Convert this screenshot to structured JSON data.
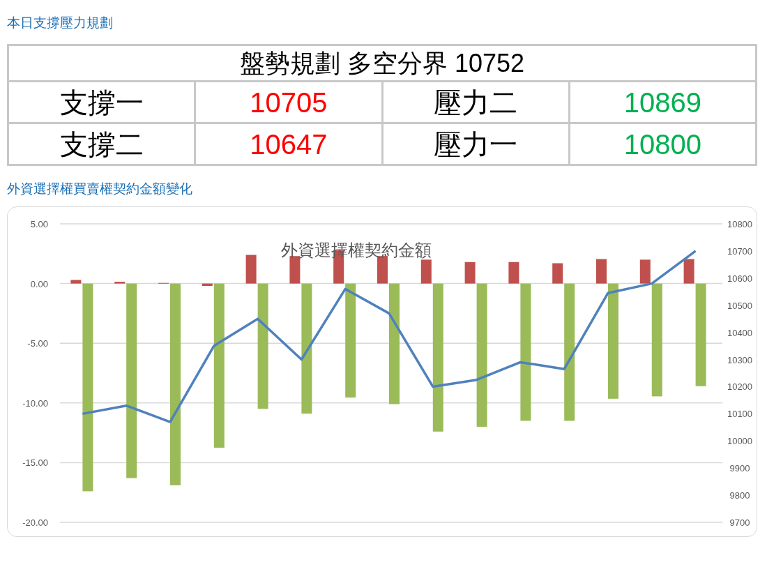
{
  "section1_heading": "本日支撐壓力規劃",
  "plan_table": {
    "title": "盤勢規劃 多空分界 10752",
    "rows": [
      [
        {
          "text": "支撐一",
          "kind": "label"
        },
        {
          "text": "10705",
          "kind": "support"
        },
        {
          "text": "壓力二",
          "kind": "label"
        },
        {
          "text": "10869",
          "kind": "resistance"
        }
      ],
      [
        {
          "text": "支撐二",
          "kind": "label"
        },
        {
          "text": "10647",
          "kind": "support"
        },
        {
          "text": "壓力一",
          "kind": "label"
        },
        {
          "text": "10800",
          "kind": "resistance"
        }
      ]
    ]
  },
  "section2_heading": "外資選擇權買賣權契約金額變化",
  "chart": {
    "chart_data": {
      "type": "bar",
      "title": "外資選擇權契約金額",
      "series": [
        {
          "color": "#c0504d",
          "values": [
            0.3,
            0.15,
            0.05,
            -0.2,
            2.4,
            2.3,
            2.8,
            2.3,
            2.0,
            1.8,
            1.8,
            1.7,
            2.05,
            2.0,
            2.05
          ]
        },
        {
          "color": "#9bbb59",
          "values": [
            -17.4,
            -16.3,
            -16.9,
            -13.75,
            -10.5,
            -10.9,
            -9.55,
            -10.1,
            -12.4,
            -12.0,
            -11.5,
            -11.5,
            -9.65,
            -9.45,
            -8.6
          ]
        },
        {
          "color": "#4f81bd",
          "type": "line",
          "axis": "y2",
          "values": [
            10100,
            10130,
            10070,
            10350,
            10450,
            10300,
            10560,
            10470,
            10200,
            10225,
            10290,
            10265,
            10545,
            10580,
            10700
          ]
        }
      ],
      "stacked": false,
      "grid": true,
      "ylim": [
        -20,
        5
      ],
      "yticks": [
        {
          "value": 5,
          "label": "5.00"
        },
        {
          "value": 0,
          "label": "0.00"
        },
        {
          "value": -5,
          "label": "-5.00"
        },
        {
          "value": -10,
          "label": "-10.00"
        },
        {
          "value": -15,
          "label": "-15.00"
        },
        {
          "value": -20,
          "label": "-20.00"
        }
      ],
      "y2lim": [
        9700,
        10800
      ],
      "y2ticks": [
        10800,
        10700,
        10600,
        10500,
        10400,
        10300,
        10200,
        10100,
        10000,
        9900,
        9800,
        9700
      ]
    }
  }
}
